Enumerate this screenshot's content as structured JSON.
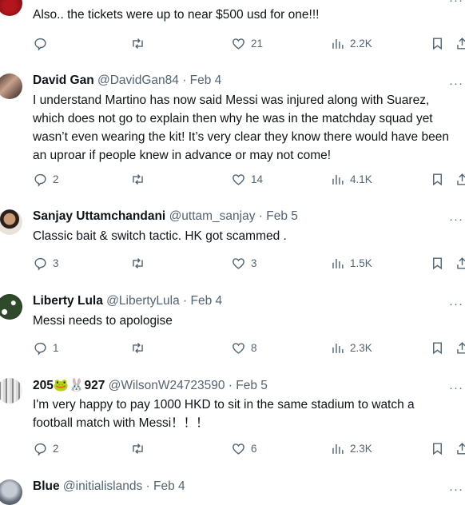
{
  "tweets": [
    {
      "name": "",
      "handle": "",
      "date": "",
      "text": "Also.. the tickets were up to near $500 usd for one!!!",
      "replies": "",
      "likes": "21",
      "views": "2.2K",
      "avatar_icon": "avatar-red-icon"
    },
    {
      "name": "David Gan",
      "handle": "@DavidGan84",
      "date": "Feb 4",
      "text": "I understand Martino has now said Messi was injured along with Suarez, which does not go to explain then why he was in the matchday squad yet wasn’t even wearing the kit! It’s very clear they know there would have been an uproar if people knew in advance or may not come!",
      "replies": "2",
      "likes": "14",
      "views": "4.1K",
      "avatar_icon": "avatar-couple-photo-icon"
    },
    {
      "name": "Sanjay Uttamchandani",
      "handle": "@uttam_sanjay",
      "date": "Feb 5",
      "text": "Classic bait & switch tactic. HK got scammed .",
      "replies": "3",
      "likes": "3",
      "views": "1.5K",
      "avatar_icon": "avatar-man-photo-icon"
    },
    {
      "name": "Liberty Lula",
      "handle": "@LibertyLula",
      "date": "Feb 4",
      "text": "Messi needs to apologise",
      "replies": "1",
      "likes": "8",
      "views": "2.3K",
      "avatar_icon": "avatar-flowers-photo-icon"
    },
    {
      "name": "205🐸🐰927",
      "handle": "@WilsonW24723590",
      "date": "Feb 5",
      "text": "I'm very happy to pay 1000 HKD to sit in the same stadium to watch a football match with Messi！！！",
      "replies": "2",
      "likes": "6",
      "views": "2.3K",
      "avatar_icon": "avatar-crowd-photo-icon"
    },
    {
      "name": "Blue",
      "handle": "@initialislands",
      "date": "Feb 4",
      "text": "",
      "avatar_icon": "avatar-blue-photo-icon"
    }
  ],
  "separator": " · ",
  "more_glyph": "···",
  "icons": [
    "reply-icon",
    "retweet-icon",
    "like-icon",
    "views-icon",
    "bookmark-icon",
    "share-icon"
  ]
}
